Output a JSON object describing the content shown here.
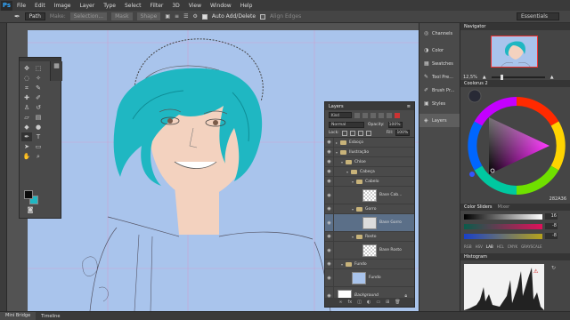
{
  "app": {
    "logo": "Ps"
  },
  "menu": [
    "File",
    "Edit",
    "Image",
    "Layer",
    "Type",
    "Select",
    "Filter",
    "3D",
    "View",
    "Window",
    "Help"
  ],
  "options_bar": {
    "tool_mode": "Path",
    "make_label": "Make:",
    "selection_btn": "Selection...",
    "mask_btn": "Mask",
    "shape_btn": "Shape",
    "auto_add_delete": "Auto Add/Delete",
    "align_edges": "Align Edges",
    "workspace": "Essentials"
  },
  "dock": {
    "items": [
      {
        "label": "Channels",
        "icon": "channels-icon"
      },
      {
        "label": "Color",
        "icon": "color-icon"
      },
      {
        "label": "Swatches",
        "icon": "swatches-icon"
      },
      {
        "label": "Tool Pre...",
        "icon": "tool-presets-icon"
      },
      {
        "label": "Brush Pr...",
        "icon": "brush-presets-icon"
      },
      {
        "label": "Styles",
        "icon": "styles-icon"
      },
      {
        "label": "Layers",
        "icon": "layers-icon"
      }
    ]
  },
  "navigator": {
    "tab": "Navigator",
    "zoom": "12,5%"
  },
  "coolorus": {
    "tab": "Coolorus 2",
    "hex": "282A36"
  },
  "color_sliders": {
    "tab": "Color Sliders",
    "tab2": "Mixer",
    "values": [
      "16",
      "-8",
      "-8"
    ],
    "modes": [
      "RGB",
      "HSV",
      "LAB",
      "HCL",
      "CMYK",
      "GRAYSCALE"
    ],
    "active_mode": "LAB"
  },
  "histogram": {
    "tab": "Histogram"
  },
  "layers": {
    "tab": "Layers",
    "kind": "Kind",
    "blend_mode": "Normal",
    "opacity_label": "Opacity:",
    "opacity": "100%",
    "lock_label": "Lock:",
    "fill_label": "Fill:",
    "fill": "100%",
    "rows": [
      {
        "name": "Esboço",
        "type": "folder",
        "indent": 0
      },
      {
        "name": "Ilustração",
        "type": "folder",
        "indent": 0
      },
      {
        "name": "Chloe",
        "type": "folder",
        "indent": 1
      },
      {
        "name": "Cabeça",
        "type": "folder",
        "indent": 2
      },
      {
        "name": "Cabelo",
        "type": "folder",
        "indent": 3
      },
      {
        "name": "Base Cab...",
        "type": "layer",
        "indent": 4,
        "thumb": "checker"
      },
      {
        "name": "Gorro",
        "type": "folder",
        "indent": 3
      },
      {
        "name": "Base Gorro",
        "type": "layer",
        "indent": 4,
        "thumb": "gray",
        "selected": true
      },
      {
        "name": "Rosto",
        "type": "folder",
        "indent": 3
      },
      {
        "name": "Base Rosto",
        "type": "layer",
        "indent": 4,
        "thumb": "checker"
      },
      {
        "name": "Fundo",
        "type": "folder",
        "indent": 1
      },
      {
        "name": "Fundo",
        "type": "layer",
        "indent": 2,
        "thumb": "blue"
      },
      {
        "name": "Background",
        "type": "layer",
        "indent": 0,
        "thumb": "white",
        "locked": true
      }
    ]
  },
  "bottom_tabs": [
    "Mini Bridge",
    "Timeline"
  ],
  "colors": {
    "canvas_bg": "#a9c4ec",
    "hair": "#1fb7c2",
    "skin": "#f3d2bf",
    "foreground": "#0b0b0b",
    "background_swatch": "#1fb7c2"
  }
}
